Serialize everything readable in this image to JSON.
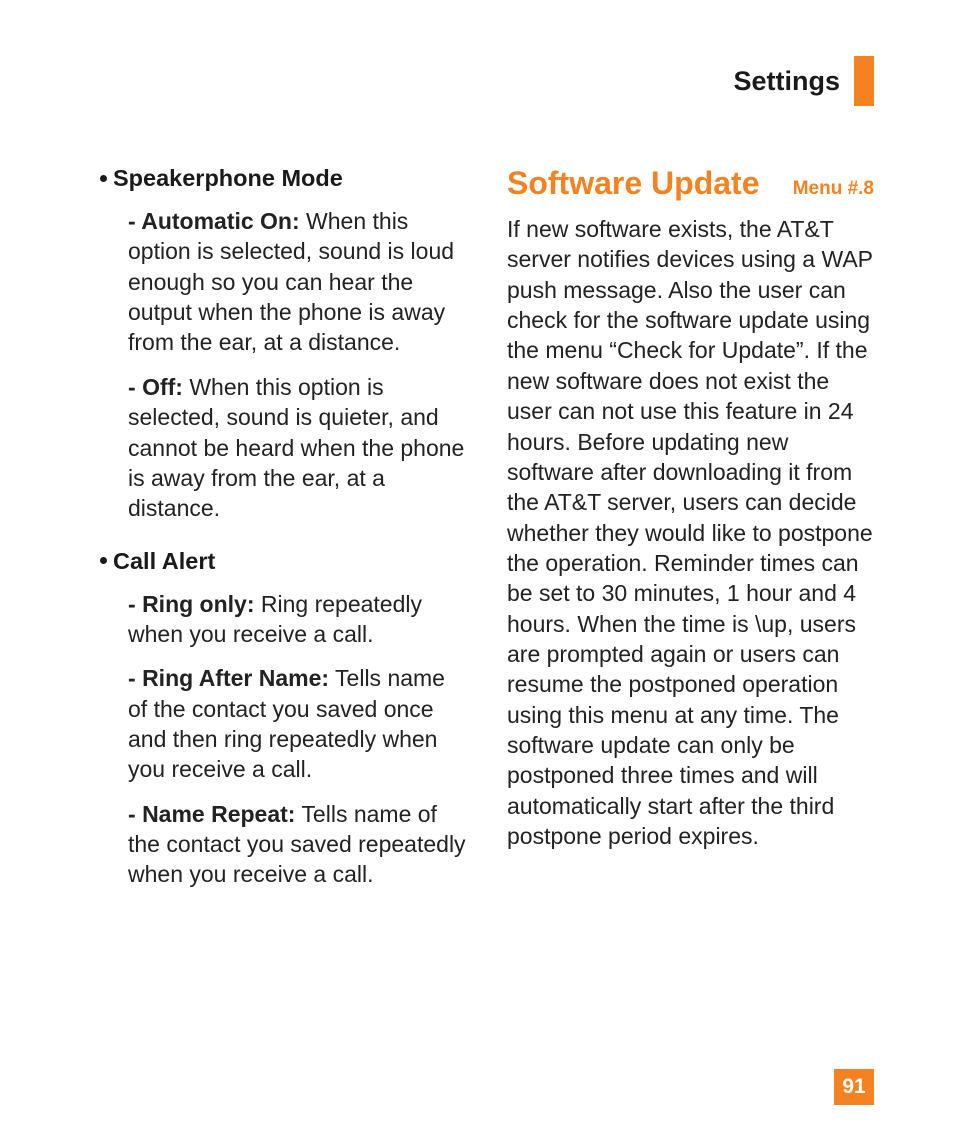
{
  "header": {
    "title": "Settings"
  },
  "left": {
    "speakerphone": {
      "title": "Speakerphone Mode",
      "items": [
        {
          "label": "Automatic On:",
          "text": " When this option is selected, sound is loud enough so you can hear the output when the phone is away from the ear, at a distance."
        },
        {
          "label": "Off:",
          "text": " When this option is selected, sound is quieter, and cannot be heard when the phone is away from the ear, at a distance."
        }
      ]
    },
    "callalert": {
      "title": "Call Alert",
      "items": [
        {
          "label": "Ring only:",
          "text": " Ring repeatedly when you receive a call."
        },
        {
          "label": "Ring After Name:",
          "text": " Tells name of the contact you saved once and then ring repeatedly when you receive a call."
        },
        {
          "label": "Name Repeat:",
          "text": " Tells name of the contact you saved repeatedly when you receive a call."
        }
      ]
    }
  },
  "right": {
    "heading": "Software Update",
    "menu": "Menu #.8",
    "paragraph": "If new software exists, the AT&T server notifies devices using a WAP push message. Also the user can check for the software update using the menu “Check for Update”. If the new software does not exist the user can not use this feature in 24 hours. Before updating new software after downloading it from the AT&T server, users can decide whether they would like to postpone the operation. Reminder times can be set to 30 minutes, 1 hour and 4 hours. When the time is \\up, users are prompted again or users can resume the postponed operation using this menu at any time. The software update can only be postponed three times and will automatically start after the third postpone period expires."
  },
  "pageNumber": "91"
}
